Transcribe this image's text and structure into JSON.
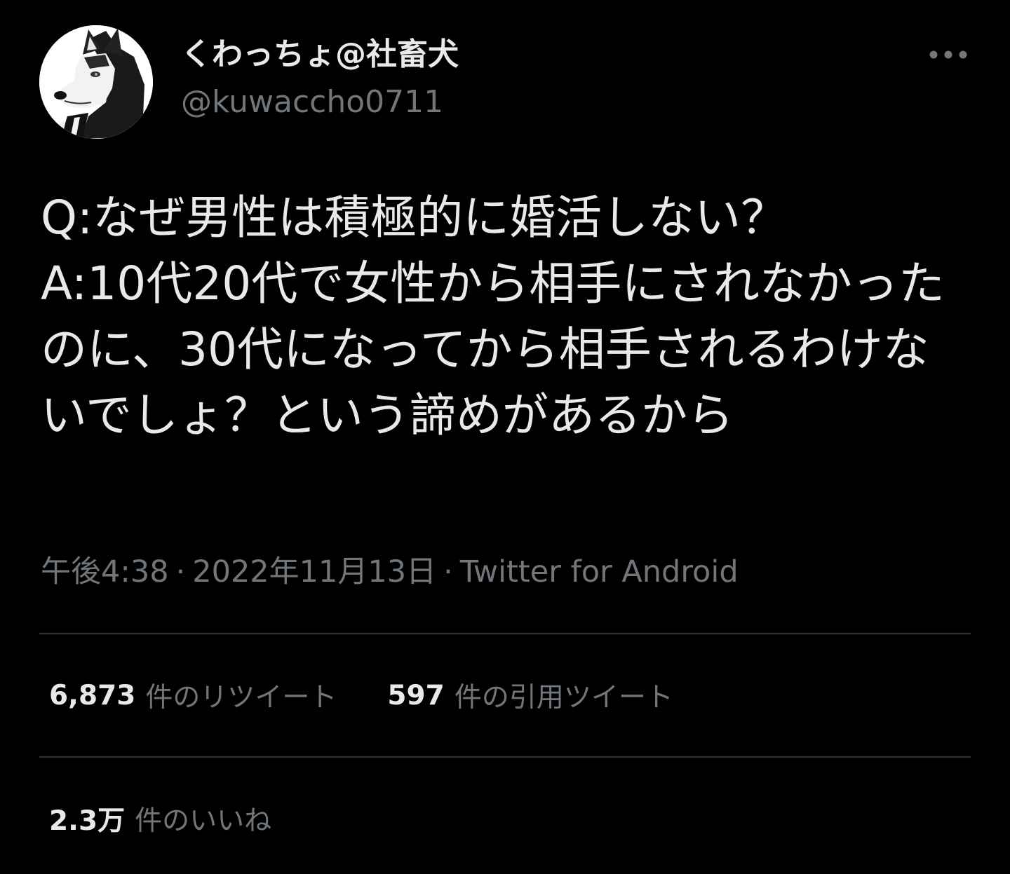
{
  "user": {
    "display_name": "くわっちょ@社畜犬",
    "handle": "@kuwaccho0711",
    "avatar_icon": "husky-dog-avatar"
  },
  "more_icon": "more-horizontal-icon",
  "tweet": {
    "text": "Q:なぜ男性は積極的に婚活しない？\nA:10代20代で女性から相手にされなかったのに、30代になってから相手されるわけないでしょ？という諦めがあるから"
  },
  "meta": {
    "time": "午後4:38",
    "separator": "·",
    "date": "2022年11月13日",
    "source": "Twitter for Android"
  },
  "stats": {
    "retweets": {
      "count": "6,873",
      "label": "件のリツイート"
    },
    "quotes": {
      "count": "597",
      "label": "件の引用ツイート"
    },
    "likes": {
      "count": "2.3万",
      "label": "件のいいね"
    }
  },
  "colors": {
    "background": "#000000",
    "primary_text": "#e7e9ea",
    "secondary_text": "#71767b",
    "divider": "#2f3336"
  }
}
